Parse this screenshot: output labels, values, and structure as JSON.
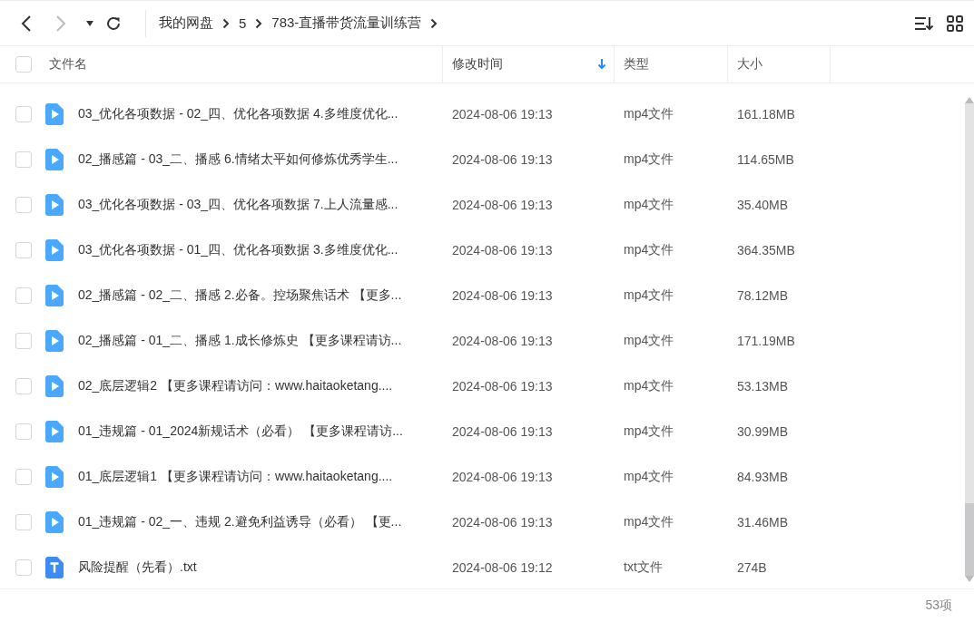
{
  "breadcrumb": [
    "我的网盘",
    "5",
    "783-直播带货流量训练营"
  ],
  "columns": [
    {
      "label": "文件名",
      "sorted": false
    },
    {
      "label": "修改时间",
      "sorted": true
    },
    {
      "label": "类型",
      "sorted": false
    },
    {
      "label": "大小",
      "sorted": false
    }
  ],
  "select_all": {
    "checked": false
  },
  "rows": [
    {
      "kind": "video",
      "checked": false,
      "name": "03_优化各项数据 - 02_四、优化各项数据  4.多维度优化...",
      "modified": "2024-08-06 19:13",
      "type": "mp4文件",
      "size": "161.18MB"
    },
    {
      "kind": "video",
      "checked": false,
      "name": "02_播感篇 - 03_二、播感  6.情绪太平如何修炼优秀学生...",
      "modified": "2024-08-06 19:13",
      "type": "mp4文件",
      "size": "114.65MB"
    },
    {
      "kind": "video",
      "checked": false,
      "name": "03_优化各项数据 - 03_四、优化各项数据  7.上人流量感...",
      "modified": "2024-08-06 19:13",
      "type": "mp4文件",
      "size": "35.40MB"
    },
    {
      "kind": "video",
      "checked": false,
      "name": "03_优化各项数据 - 01_四、优化各项数据  3.多维度优化...",
      "modified": "2024-08-06 19:13",
      "type": "mp4文件",
      "size": "364.35MB"
    },
    {
      "kind": "video",
      "checked": false,
      "name": "02_播感篇 - 02_二、播感  2.必备。控场聚焦话术 【更多...",
      "modified": "2024-08-06 19:13",
      "type": "mp4文件",
      "size": "78.12MB"
    },
    {
      "kind": "video",
      "checked": false,
      "name": "02_播感篇 - 01_二、播感  1.成长修炼史 【更多课程请访...",
      "modified": "2024-08-06 19:13",
      "type": "mp4文件",
      "size": "171.19MB"
    },
    {
      "kind": "video",
      "checked": false,
      "name": "02_底层逻辑2 【更多课程请访问：www.haitaoketang....",
      "modified": "2024-08-06 19:13",
      "type": "mp4文件",
      "size": "53.13MB"
    },
    {
      "kind": "video",
      "checked": false,
      "name": "01_违规篇 - 01_2024新规话术（必看） 【更多课程请访...",
      "modified": "2024-08-06 19:13",
      "type": "mp4文件",
      "size": "30.99MB"
    },
    {
      "kind": "video",
      "checked": false,
      "name": "01_底层逻辑1 【更多课程请访问：www.haitaoketang....",
      "modified": "2024-08-06 19:13",
      "type": "mp4文件",
      "size": "84.93MB"
    },
    {
      "kind": "video",
      "checked": false,
      "name": "01_违规篇 - 02_一、违规  2.避免利益诱导（必看） 【更...",
      "modified": "2024-08-06 19:13",
      "type": "mp4文件",
      "size": "31.46MB"
    },
    {
      "kind": "text",
      "checked": false,
      "name": "风险提醒（先看）.txt",
      "modified": "2024-08-06 19:12",
      "type": "txt文件",
      "size": "274B"
    }
  ],
  "item_count": "53项"
}
